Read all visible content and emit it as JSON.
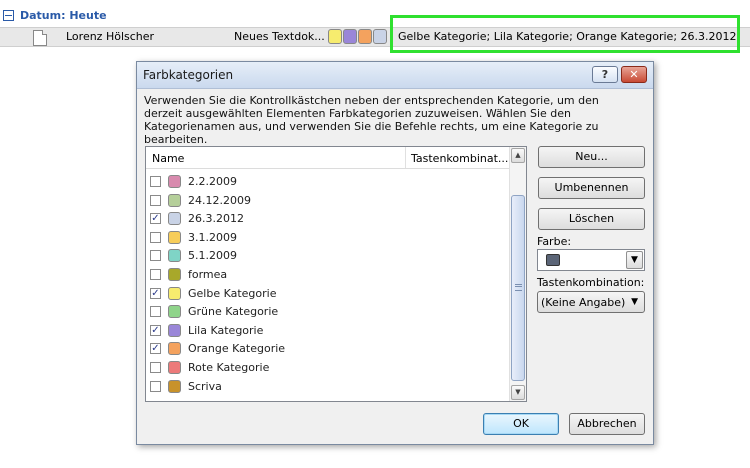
{
  "list": {
    "group_title": "Datum: Heute",
    "row": {
      "author": "Lorenz Hölscher",
      "subject": "Neues Textdok...",
      "categories_text": "Gelbe Kategorie; Lila Kategorie; Orange Kategorie; 26.3.2012",
      "swatch_colors": [
        "#f7ec6e",
        "#9a86d8",
        "#f4a25e",
        "#c9d3e6"
      ]
    },
    "highlight_color": "#2fe02f"
  },
  "dialog": {
    "title": "Farbkategorien",
    "help_label": "?",
    "close_label": "✕",
    "description": "Verwenden Sie die Kontrollkästchen neben der entsprechenden Kategorie, um den derzeit ausgewählten Elementen Farbkategorien zuzuweisen. Wählen Sie den Kategorienamen aus, und verwenden Sie die Befehle rechts, um eine Kategorie zu bearbeiten.",
    "columns": {
      "name": "Name",
      "shortcut": "Tastenkombinat..."
    },
    "categories": [
      {
        "label": "2.2.2009",
        "checked": false,
        "color": "#d88aae"
      },
      {
        "label": "24.12.2009",
        "checked": false,
        "color": "#b5cf9a"
      },
      {
        "label": "26.3.2012",
        "checked": true,
        "color": "#c9d3e6"
      },
      {
        "label": "3.1.2009",
        "checked": false,
        "color": "#f7cd5a"
      },
      {
        "label": "5.1.2009",
        "checked": false,
        "color": "#7fd4c6"
      },
      {
        "label": "formea",
        "checked": false,
        "color": "#a8a82a"
      },
      {
        "label": "Gelbe Kategorie",
        "checked": true,
        "color": "#f7ec6e"
      },
      {
        "label": "Grüne Kategorie",
        "checked": false,
        "color": "#8fd48a"
      },
      {
        "label": "Lila Kategorie",
        "checked": true,
        "color": "#9a86d8"
      },
      {
        "label": "Orange Kategorie",
        "checked": true,
        "color": "#f4a25e"
      },
      {
        "label": "Rote Kategorie",
        "checked": false,
        "color": "#ec7a7a"
      },
      {
        "label": "Scriva",
        "checked": false,
        "color": "#c8922a"
      }
    ],
    "buttons": {
      "new": "Neu...",
      "rename": "Umbenennen",
      "delete": "Löschen",
      "ok": "OK",
      "cancel": "Abbrechen"
    },
    "color_label": "Farbe:",
    "color_value": "#5b6577",
    "shortcut_label": "Tastenkombination:",
    "shortcut_value": "(Keine Angabe)"
  }
}
